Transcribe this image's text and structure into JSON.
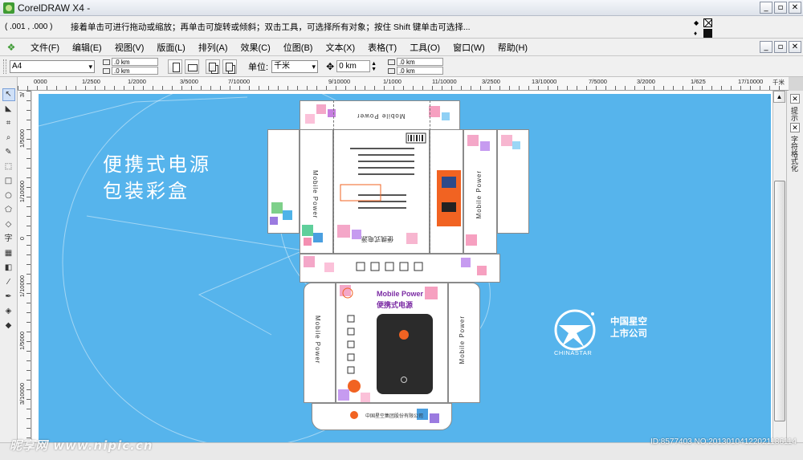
{
  "window": {
    "title": "CorelDRAW X4 -",
    "min_btn": "_",
    "restore_btn": "▫",
    "close_btn": "✕"
  },
  "hint_bar": {
    "coordinates": "( .001 , .000 )",
    "hint": "接着单击可进行拖动或缩放；再单击可旋转或倾斜；双击工具，可选择所有对象；按住 Shift 键单击可选择..."
  },
  "menu": {
    "items": [
      "文件(F)",
      "编辑(E)",
      "视图(V)",
      "版面(L)",
      "排列(A)",
      "效果(C)",
      "位图(B)",
      "文本(X)",
      "表格(T)",
      "工具(O)",
      "窗口(W)",
      "帮助(H)"
    ]
  },
  "property_bar": {
    "paper_size": "A4",
    "width": ".0 km",
    "height": ".0 km",
    "unit_label": "单位:",
    "unit_value": "千米",
    "nudge": "0 km",
    "dup_x": ".0 km",
    "dup_y": ".0 km"
  },
  "rulers": {
    "horizontal_labels": [
      "0000",
      "1/2500",
      "1/2000",
      "3/5000",
      "7/10000",
      "9/10000",
      "1/1000",
      "11/10000",
      "3/2500",
      "13/10000",
      "7/5000",
      "3/2000",
      "1/625",
      "17/10000",
      "千米"
    ],
    "vertical_labels": [
      "3/",
      "1/5000",
      "1/10000",
      "0",
      "1/10000",
      "1/5000",
      "3/10000"
    ]
  },
  "toolbox": {
    "tools": [
      "pick-tool",
      "shape-tool",
      "crop-tool",
      "zoom-tool",
      "freehand-tool",
      "smart-fill-tool",
      "rectangle-tool",
      "ellipse-tool",
      "polygon-tool",
      "basic-shapes-tool",
      "text-tool",
      "table-tool",
      "interactive-blend-tool",
      "eyedropper-tool",
      "outline-tool",
      "fill-tool",
      "interactive-fill-tool"
    ]
  },
  "artwork": {
    "headline_line1": "便携式电源",
    "headline_line2": "包装彩盒",
    "brand_cn_line1": "中国星空",
    "brand_cn_line2": "上市公司",
    "brand_en": "CHINASTAR",
    "product_en": "Mobile Power",
    "product_cn": "便携式电源",
    "company_small": "中国星空集团股份有限公司"
  },
  "dockers": {
    "tab1": "提示",
    "tab2": "字符格式化"
  },
  "watermark": {
    "left": "昵享网 www.nipic.cn",
    "right": "ID:8577403 NO:20130104122021186114"
  },
  "colors": {
    "artboard_blue": "#56b4ec",
    "accent_orange": "#f16322",
    "corel_green": "#3f9b35"
  }
}
